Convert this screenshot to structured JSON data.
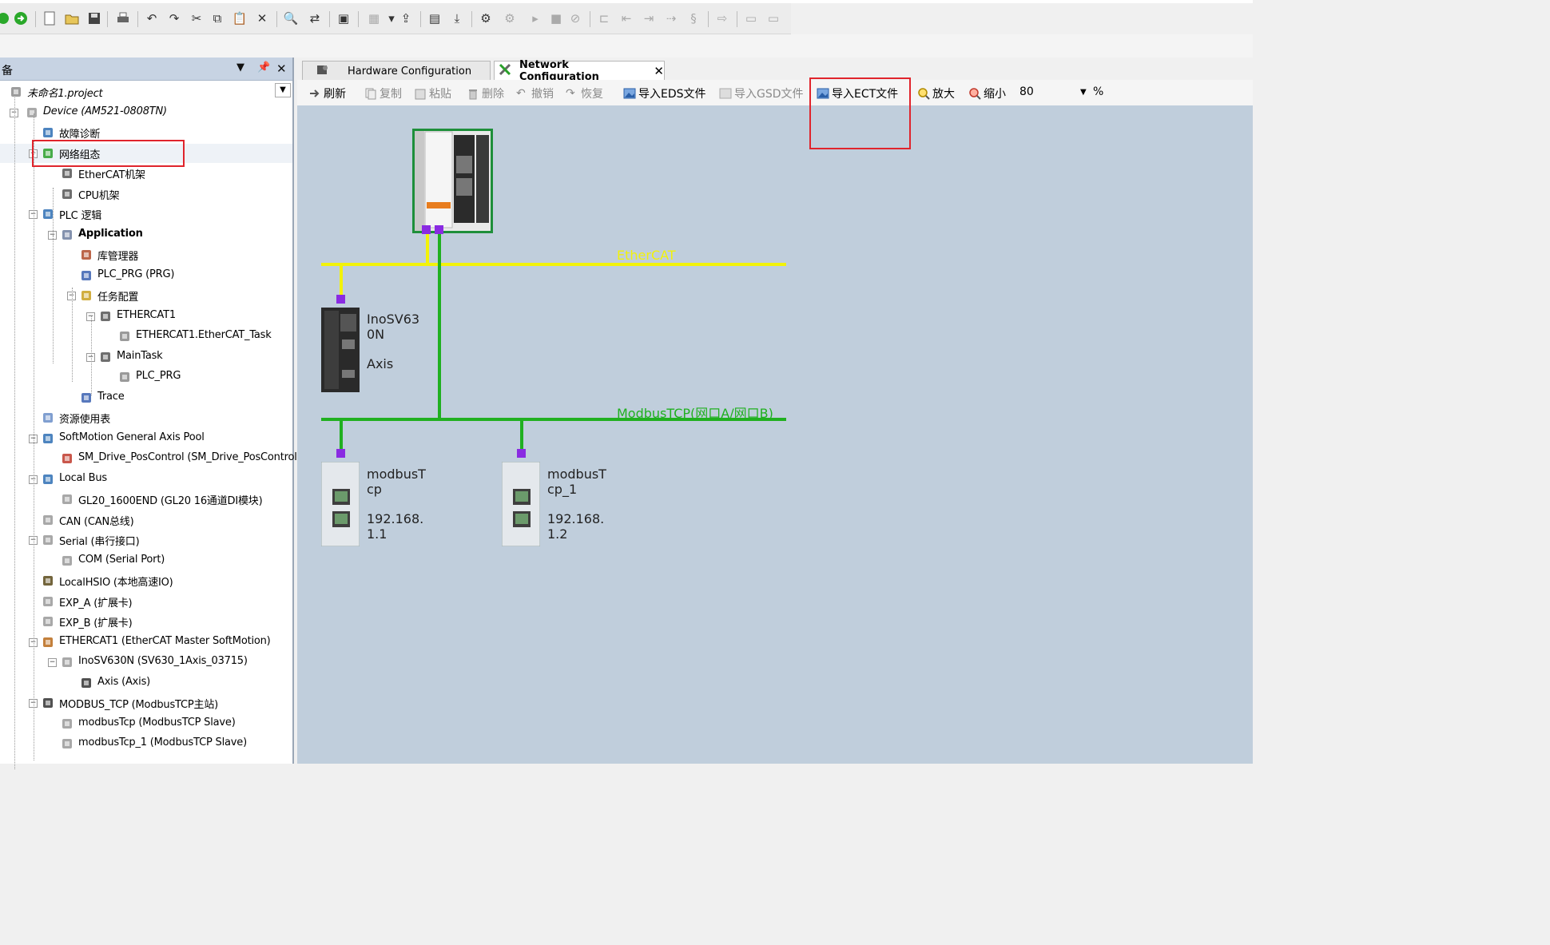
{
  "left_panel": {
    "title": "备",
    "tree": [
      {
        "label": "未命名1.project",
        "italic": true
      },
      {
        "label": "Device (AM521-0808TN)",
        "italic": true
      },
      {
        "label": "故障诊断"
      },
      {
        "label": "网络组态"
      },
      {
        "label": "EtherCAT机架"
      },
      {
        "label": "CPU机架"
      },
      {
        "label": "PLC 逻辑"
      },
      {
        "label": "Application",
        "bold": true
      },
      {
        "label": "库管理器"
      },
      {
        "label": "PLC_PRG (PRG)"
      },
      {
        "label": "任务配置"
      },
      {
        "label": "ETHERCAT1"
      },
      {
        "label": "ETHERCAT1.EtherCAT_Task"
      },
      {
        "label": "MainTask"
      },
      {
        "label": "PLC_PRG"
      },
      {
        "label": "Trace"
      },
      {
        "label": "资源使用表"
      },
      {
        "label": "SoftMotion General Axis Pool"
      },
      {
        "label": "SM_Drive_PosControl (SM_Drive_PosControl)"
      },
      {
        "label": "Local Bus"
      },
      {
        "label": "GL20_1600END (GL20 16通道DI模块)"
      },
      {
        "label": "CAN (CAN总线)"
      },
      {
        "label": "Serial (串行接口)"
      },
      {
        "label": "COM (Serial Port)"
      },
      {
        "label": "LocalHSIO (本地高速IO)"
      },
      {
        "label": "EXP_A (扩展卡)"
      },
      {
        "label": "EXP_B (扩展卡)"
      },
      {
        "label": "ETHERCAT1 (EtherCAT Master SoftMotion)"
      },
      {
        "label": "InoSV630N (SV630_1Axis_03715)"
      },
      {
        "label": "Axis (Axis)"
      },
      {
        "label": "MODBUS_TCP (ModbusTCP主站)"
      },
      {
        "label": "modbusTcp (ModbusTCP Slave)"
      },
      {
        "label": "modbusTcp_1 (ModbusTCP Slave)"
      }
    ]
  },
  "tabs": [
    {
      "label": "Hardware Configuration"
    },
    {
      "label": "Network Configuration"
    }
  ],
  "net_toolbar": {
    "refresh": "刷新",
    "copy": "复制",
    "paste": "粘贴",
    "delete": "删除",
    "undo": "撤销",
    "redo": "恢复",
    "import_eds": "导入EDS文件",
    "import_gsd": "导入GSD文件",
    "import_ect": "导入ECT文件",
    "zoom_in": "放大",
    "zoom_out": "缩小",
    "zoom_value": "80",
    "zoom_unit": "%"
  },
  "canvas": {
    "ethercat_bus_label": "EtherCAT",
    "modbus_bus_label": "ModbusTCP(网口A/网口B)",
    "servo": {
      "name": "InoSV63\n0N",
      "sub": "Axis"
    },
    "slave1": {
      "name": "modbusT\ncp",
      "ip": "192.168.\n1.1"
    },
    "slave2": {
      "name": "modbusT\ncp_1",
      "ip": "192.168.\n1.2"
    }
  },
  "colors": {
    "ethercat_bus": "#f2f20a",
    "modbus_bus": "#20b020",
    "port": "#8a2be2",
    "canvas_bg": "#c0cedc",
    "highlight": "#e0242c"
  }
}
